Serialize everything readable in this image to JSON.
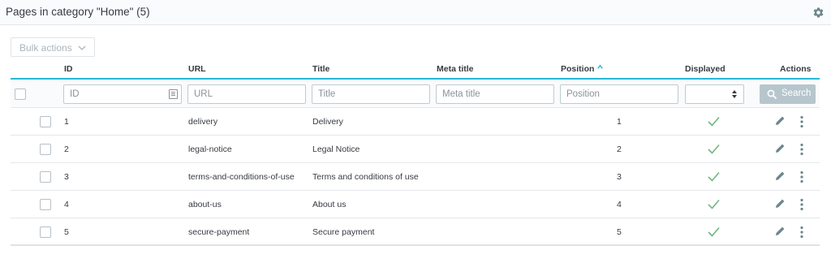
{
  "header": {
    "title": "Pages in category \"Home\" (5)",
    "settings_icon": "gear-icon"
  },
  "bulk_actions": {
    "label": "Bulk actions",
    "icon": "chevron-down-icon"
  },
  "columns": {
    "id": "ID",
    "url": "URL",
    "title": "Title",
    "meta_title": "Meta title",
    "position": "Position",
    "displayed": "Displayed",
    "actions": "Actions"
  },
  "sort": {
    "column": "position",
    "direction": "ascending",
    "icon": "sort-asc-icon"
  },
  "filters": {
    "id_placeholder": "ID",
    "url_placeholder": "URL",
    "title_placeholder": "Title",
    "meta_title_placeholder": "Meta title",
    "position_placeholder": "Position",
    "displayed_value": "",
    "search_label": "Search"
  },
  "rows": [
    {
      "id": "1",
      "url": "delivery",
      "title": "Delivery",
      "meta_title": "",
      "position": "1",
      "displayed": true
    },
    {
      "id": "2",
      "url": "legal-notice",
      "title": "Legal Notice",
      "meta_title": "",
      "position": "2",
      "displayed": true
    },
    {
      "id": "3",
      "url": "terms-and-conditions-of-use",
      "title": "Terms and conditions of use",
      "meta_title": "",
      "position": "3",
      "displayed": true
    },
    {
      "id": "4",
      "url": "about-us",
      "title": "About us",
      "meta_title": "",
      "position": "4",
      "displayed": true
    },
    {
      "id": "5",
      "url": "secure-payment",
      "title": "Secure payment",
      "meta_title": "",
      "position": "5",
      "displayed": true
    }
  ],
  "colors": {
    "accent": "#25b9d7",
    "check": "#70b580",
    "search_button": "#b7c6cd",
    "text": "#363a41"
  }
}
